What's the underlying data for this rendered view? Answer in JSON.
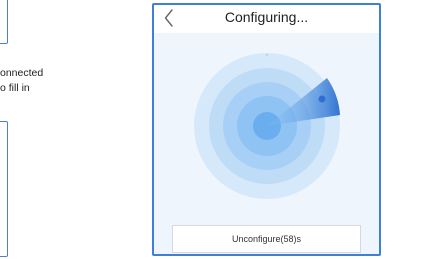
{
  "left_panel": {
    "line1": "onnected",
    "line2": "o fill in"
  },
  "dialog": {
    "title": "Configuring...",
    "back_icon": "chevron-left-icon",
    "radar_icon": "radar-scan-icon",
    "unconfigure_label": "Unconfigure(58)s"
  },
  "colors": {
    "accent": "#3f7fd8",
    "radar_center": "#6aaef0",
    "radar_sweep": "#2f73d1"
  }
}
